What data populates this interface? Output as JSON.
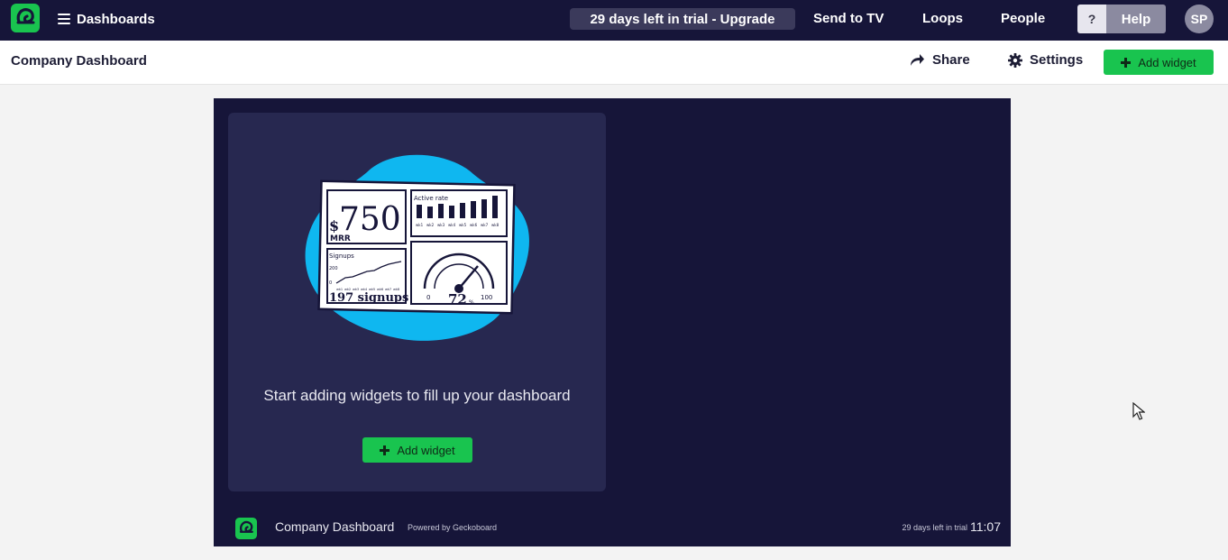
{
  "topbar": {
    "dashboards_label": "Dashboards",
    "trial_label": "29 days left in trial - Upgrade",
    "send_to_tv_label": "Send to TV",
    "loops_label": "Loops",
    "people_label": "People",
    "help_question": "?",
    "help_label": "Help",
    "avatar_initials": "SP"
  },
  "subbar": {
    "title": "Company Dashboard",
    "share_label": "Share",
    "settings_label": "Settings",
    "add_widget_label": "Add widget"
  },
  "board": {
    "empty_message": "Start adding widgets to fill up your dashboard",
    "add_widget_label": "Add widget",
    "illustration": {
      "mrr_currency": "$",
      "mrr_value": "750",
      "mrr_label": "MRR",
      "active_rate_label": "Active rate",
      "week_labels": [
        "wk1",
        "wk2",
        "wk3",
        "wk4",
        "wk5",
        "wk6",
        "wk7",
        "wk8"
      ],
      "signups_label": "Signups",
      "signups_axis_top": "200",
      "signups_axis_bottom": "0",
      "signups_total": "197 signups",
      "gauge_min": "0",
      "gauge_max": "100",
      "gauge_value": "72",
      "gauge_unit": "%"
    },
    "footer": {
      "title": "Company Dashboard",
      "powered_by": "Powered by Geckoboard",
      "trial_text": "29 days left in trial",
      "time": "11:07"
    }
  },
  "colors": {
    "nav_bg": "#161539",
    "board_bg": "#161539",
    "card_bg": "#272850",
    "accent_green": "#19c44f",
    "blob_blue": "#0fb7f0"
  },
  "icons": {
    "logo": "geckoboard-logo-icon",
    "menu": "hamburger-icon",
    "share": "share-arrow-icon",
    "settings": "gear-icon",
    "add": "plus-icon"
  }
}
